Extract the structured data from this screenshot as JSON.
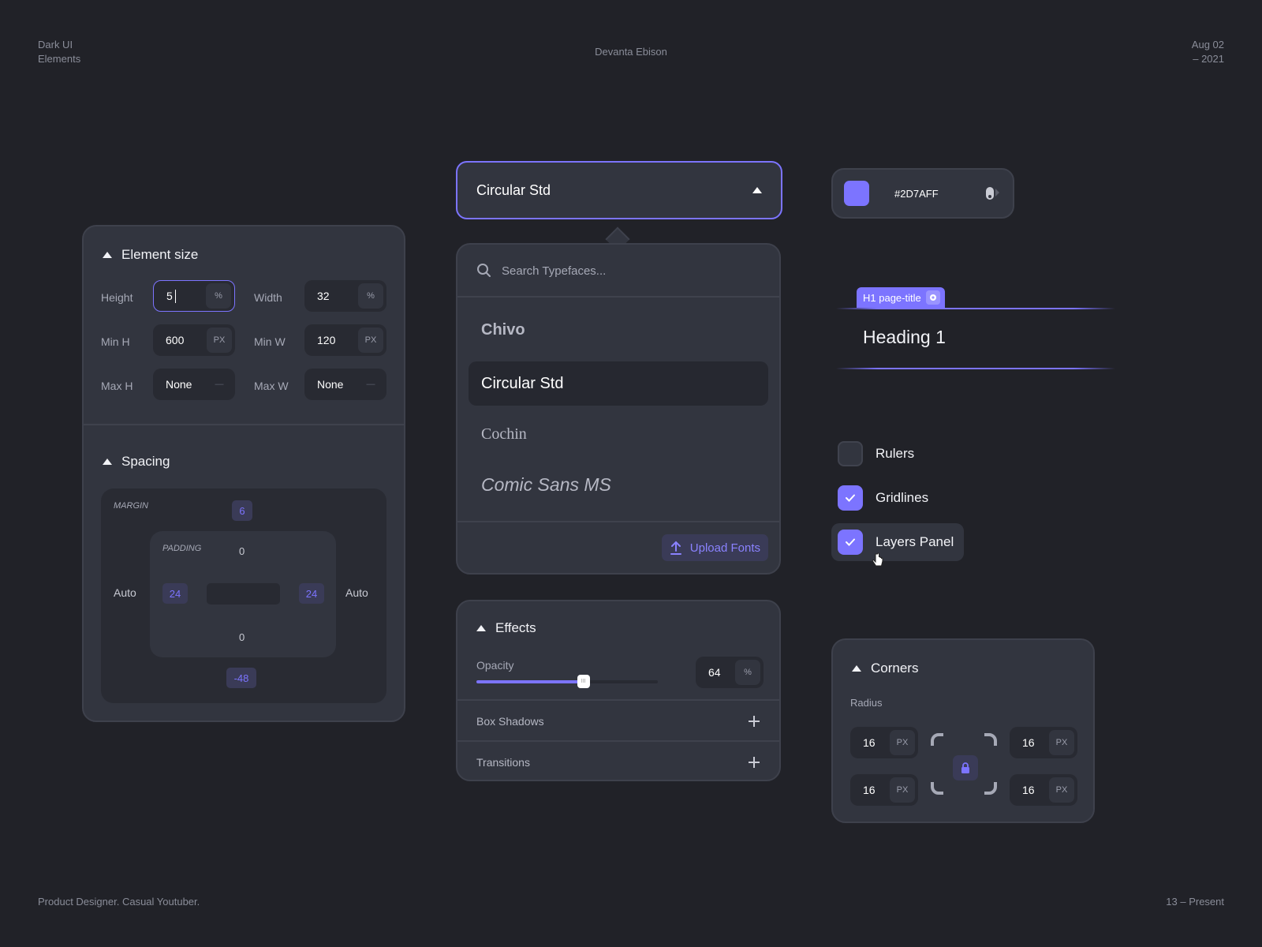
{
  "header": {
    "left_line1": "Dark UI",
    "left_line2": "Elements",
    "center": "Devanta Ebison",
    "right_line1": "Aug 02",
    "right_line2": "– 2021"
  },
  "footer": {
    "left": "Product Designer. Casual Youtuber.",
    "right": "13 – Present"
  },
  "element_size": {
    "title": "Element size",
    "rows": [
      {
        "label_a": "Height",
        "value_a": "5",
        "unit_a": "%",
        "label_b": "Width",
        "value_b": "32",
        "unit_b": "%"
      },
      {
        "label_a": "Min H",
        "value_a": "600",
        "unit_a": "PX",
        "label_b": "Min W",
        "value_b": "120",
        "unit_b": "PX"
      },
      {
        "label_a": "Max H",
        "value_a": "None",
        "unit_a": "—",
        "label_b": "Max W",
        "value_b": "None",
        "unit_b": "—"
      }
    ]
  },
  "spacing": {
    "title": "Spacing",
    "margin_label": "MARGIN",
    "padding_label": "PADDING",
    "margin_top": "6",
    "margin_bottom": "-48",
    "margin_left": "Auto",
    "margin_right": "Auto",
    "padding_top": "0",
    "padding_bottom": "0",
    "padding_left": "24",
    "padding_right": "24"
  },
  "font_select": {
    "selected": "Circular Std",
    "search_placeholder": "Search Typefaces...",
    "options": [
      "Chivo",
      "Circular Std",
      "Cochin",
      "Comic Sans MS"
    ],
    "upload_label": "Upload Fonts"
  },
  "effects": {
    "title": "Effects",
    "opacity_label": "Opacity",
    "opacity_value": "64",
    "opacity_unit": "%",
    "opacity_fraction": 0.59,
    "box_shadows_label": "Box Shadows",
    "transitions_label": "Transitions"
  },
  "color_picker": {
    "hex": "#2D7AFF",
    "swatch_color": "#7c74ff"
  },
  "heading_tag": {
    "tag_label": "H1 page-title",
    "heading_text": "Heading 1"
  },
  "checkboxes": [
    {
      "label": "Rulers",
      "checked": false
    },
    {
      "label": "Gridlines",
      "checked": true
    },
    {
      "label": "Layers Panel",
      "checked": true
    }
  ],
  "corners": {
    "title": "Corners",
    "radius_label": "Radius",
    "top_left": "16",
    "top_right": "16",
    "bottom_left": "16",
    "bottom_right": "16",
    "unit": "PX"
  },
  "colors": {
    "accent": "#7c74ff",
    "background": "#212228",
    "panel": "#32353f"
  }
}
